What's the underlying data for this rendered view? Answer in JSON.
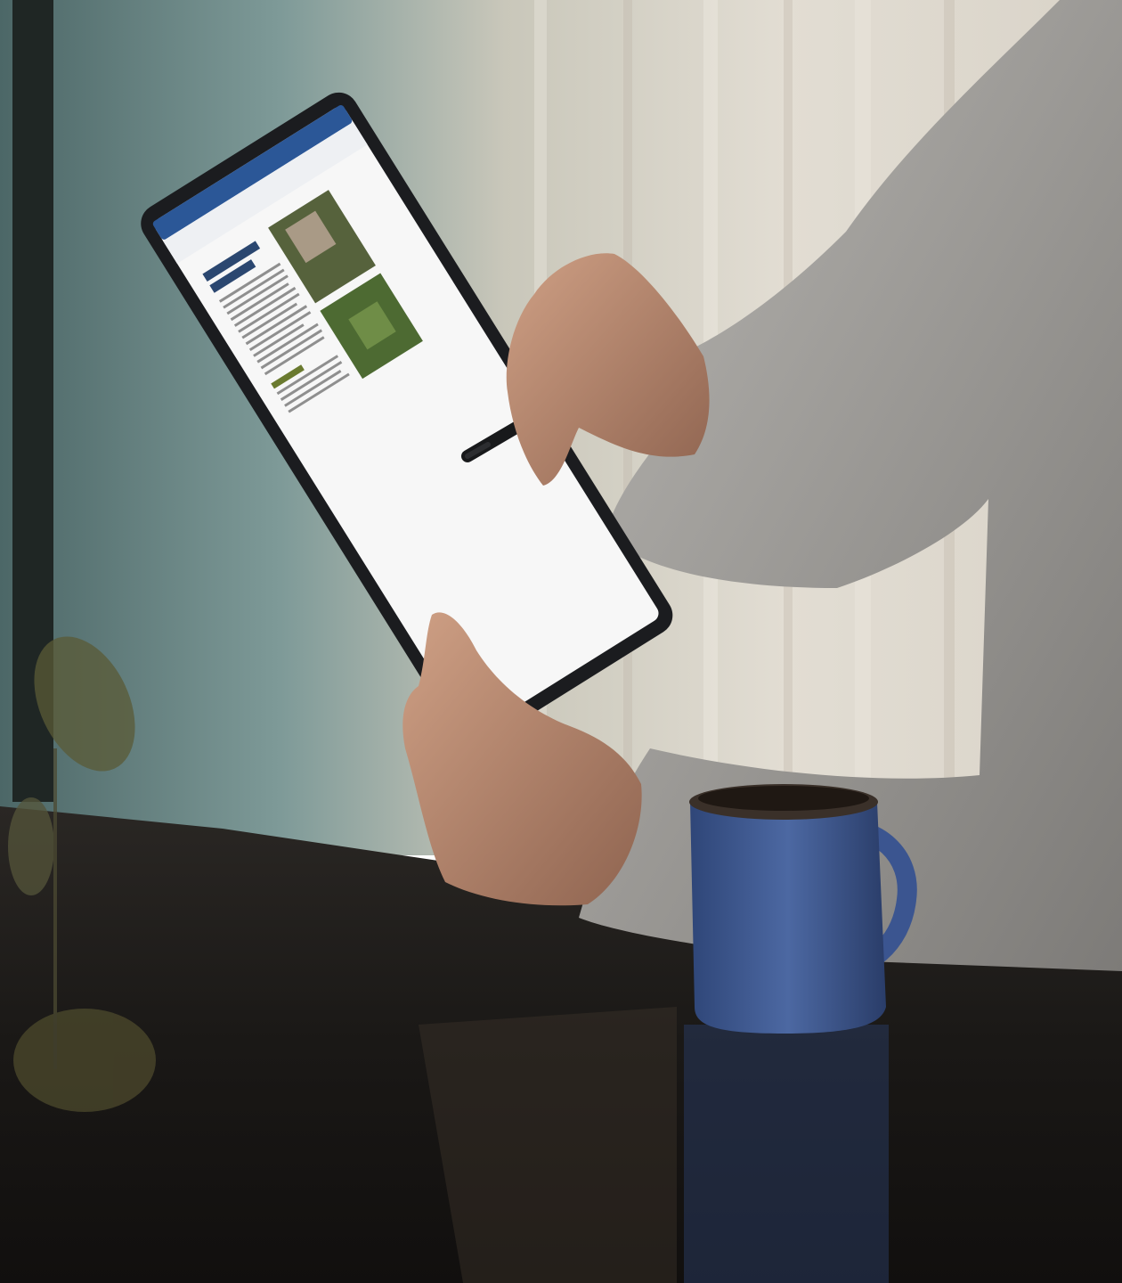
{
  "scene": {
    "palette": {
      "wall_teal": "#6f8e8c",
      "curtain_cream": "#d9d2c4",
      "table_dark": "#1c1a18",
      "sweater_gray": "#9c9a97",
      "skin": "#b98a6f",
      "mug_blue": "#3f5a8f",
      "tablet_frame": "#1b1c1f",
      "word_ribbon": "#2b5797"
    },
    "icons": [
      "tablet-icon",
      "stylus-icon",
      "mug-icon",
      "plant-icon"
    ]
  }
}
